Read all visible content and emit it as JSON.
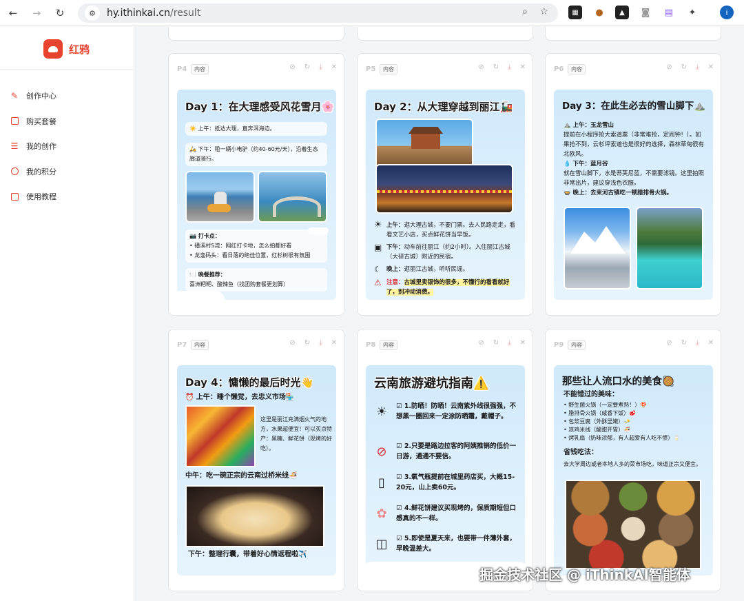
{
  "browser": {
    "url_host": "hy.ithinkai.cn",
    "url_path": "/result",
    "profile_initial": "i"
  },
  "sidebar": {
    "brand": "红鸦",
    "items": [
      {
        "label": "创作中心",
        "icon": "pen-icon"
      },
      {
        "label": "购买套餐",
        "icon": "card-icon"
      },
      {
        "label": "我的创作",
        "icon": "list-icon"
      },
      {
        "label": "我的积分",
        "icon": "clock-icon"
      },
      {
        "label": "使用教程",
        "icon": "doc-icon"
      }
    ]
  },
  "cards": [
    {
      "page": "P4",
      "tag": "内容",
      "title": "Day 1：在大理感受风花雪月🌸",
      "morning": "☀️ 上午：抵达大理，直奔洱海边。",
      "afternoon": "🛵 下午：租一辆小电驴（约40-60元/天），沿着生态廊道骑行。",
      "checkin_title": "📷 打卡点：",
      "checkin_1": "• 磻溪村S湾：网红打卡地，怎么拍都好看",
      "checkin_2": "• 龙龛码头：看日落的绝佳位置，红杉树很有氛围",
      "dinner_title": "🍽️ 晚餐推荐：",
      "dinner": "喜洲粑粑、酸辣鱼（找团购套餐更划算）"
    },
    {
      "page": "P5",
      "tag": "内容",
      "title": "Day 2：从大理穿越到丽江🚂",
      "morning_label": "上午：",
      "morning": "逛大理古城，不要门票。去人民路走走，看看文艺小店，买点鲜花饼当早饭。",
      "afternoon_label": "下午：",
      "afternoon": "动车前往丽江（约2小时）。入住丽江古城（大研古城）附近的民宿。",
      "evening_label": "晚上：",
      "evening": "逛丽江古城，听听民谣。",
      "note_label": "注意：",
      "note": "古城里卖银饰的很多，不懂行的看看就好了，别冲动消费。"
    },
    {
      "page": "P6",
      "tag": "内容",
      "title": "Day 3：在此生必去的雪山脚下⛰️",
      "morning_label": "⛰️ 上午：玉龙雪山",
      "morning": "提前在小程序抢大索道票（非常难抢，定闹钟！）。如果抢不到，云杉坪索道也是很好的选择，森林草甸很有北欧风。",
      "afternoon_label": "💧 下午：蓝月谷",
      "afternoon": "就在雪山脚下，水是蒂芙尼蓝，不需要滤镜。这里拍照非常出片，建议穿浅色衣服。",
      "evening": "🍲 晚上：去束河古镇吃一顿腊排骨火锅。"
    },
    {
      "page": "P7",
      "tag": "内容",
      "title": "Day 4：慵懒的最后时光👋",
      "morning": "⏰ 上午：睡个懒觉，去忠义市场🏪",
      "market_desc": "这里是丽江充满烟火气的地方，水果超便宜！可以买点特产：黑糖、鲜花饼（现烤的好吃）。",
      "noon": "中午：吃一碗正宗的云南过桥米线🍜",
      "afternoon": "下午：整理行囊，带着好心情返程啦✈️"
    },
    {
      "page": "P8",
      "tag": "内容",
      "title": "云南旅游避坑指南⚠️",
      "tips": [
        "☑ 1.防晒！防晒！云南紫外线很强强，不想黑一圈回来一定涂防晒霜，戴帽子。",
        "☑ 2.只要是路边拉客的阿姨推销的低价一日游，通通不要信。",
        "☑ 3.氧气瓶提前在城里药店买，大概15-20元，山上卖60元。",
        "☑ 4.鲜花饼建议买现烤的，保质期短但口感真的不一样。",
        "☑ 5.即使是夏天来，也要带一件薄外套，早晚温差大。"
      ]
    },
    {
      "page": "P9",
      "tag": "内容",
      "title": "那些让人流口水的美食🥘",
      "must_title": "不能错过的美味：",
      "foods": [
        "• 野生菌火锅（一定要煮熟！）🍄",
        "• 腊排骨火锅（咸香下饭）🥩",
        "• 包浆豆腐（外酥里嫩）🧈",
        "• 凉鸡米线（酸甜开胃）🍜",
        "• 烤乳扇（奶味浓郁，有人超爱有人吃不惯）🥛"
      ],
      "save_title": "省钱吃法：",
      "save": "去大学周边或者本地人多的菜市场吃，味道正宗又便宜。"
    }
  ],
  "watermark": "掘金技术社区 @ iThinkAI智能体"
}
